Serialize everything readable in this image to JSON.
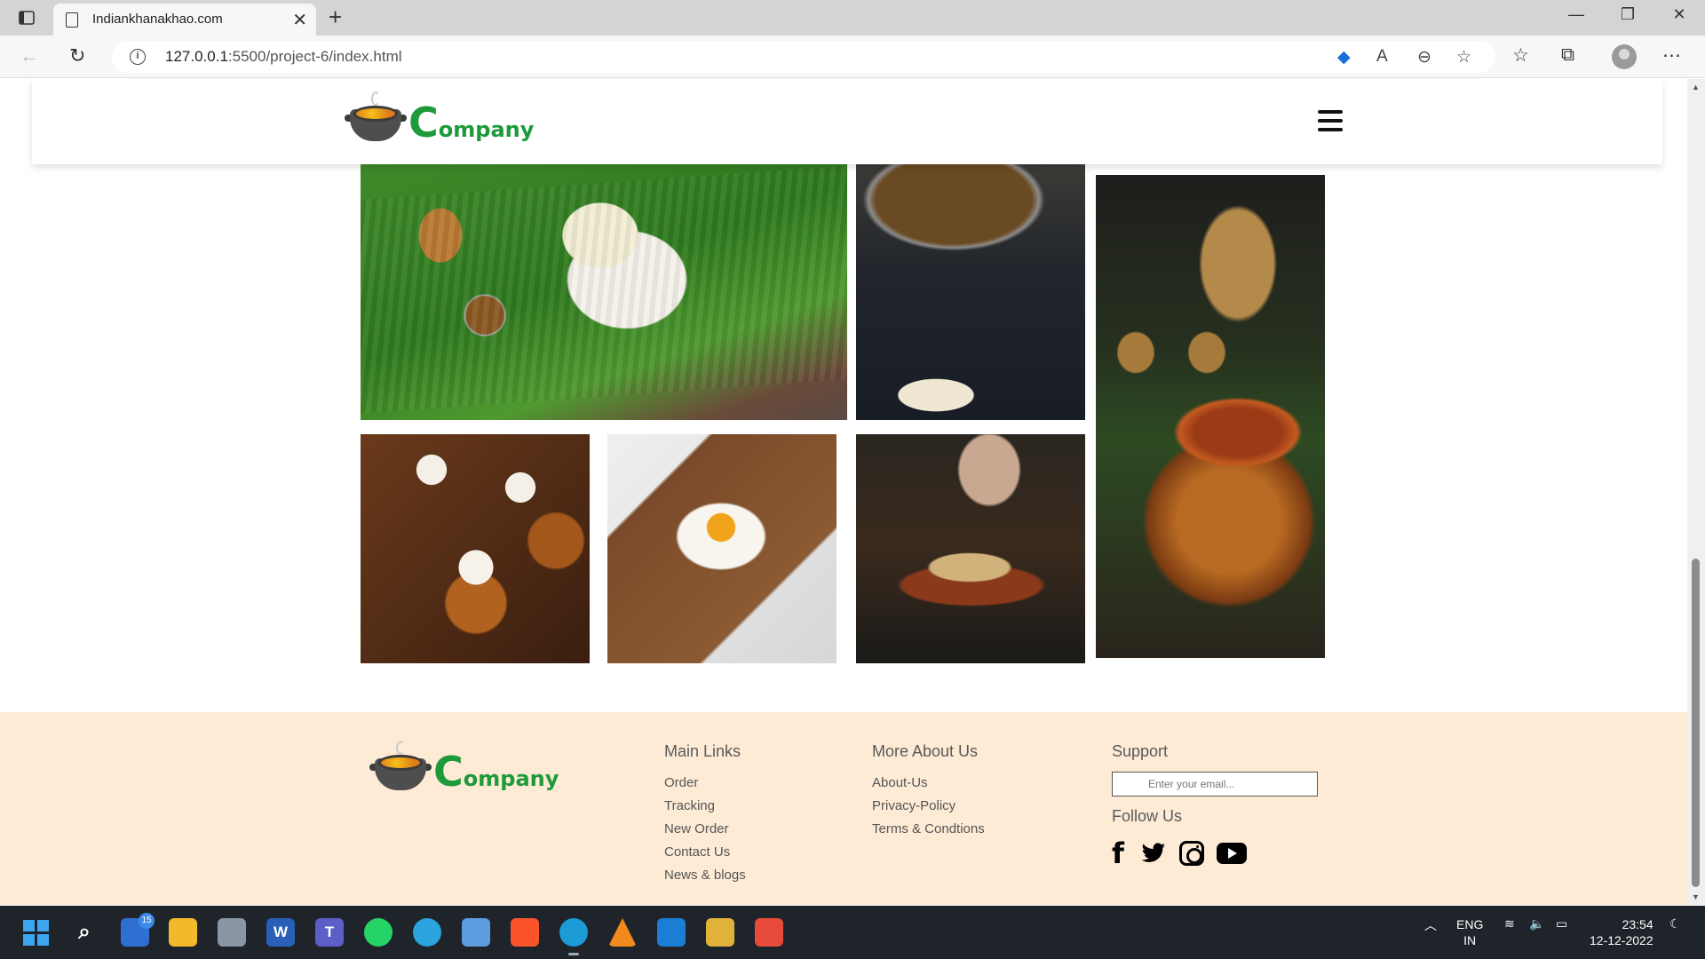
{
  "browser": {
    "tab_title": "Indiankhanakhao.com",
    "tab_close": "✕",
    "new_tab": "+",
    "url_host": "127.0.0.1",
    "url_path": ":5500/project-6/index.html",
    "window_controls": {
      "minimize": "—",
      "restore": "❐",
      "close": "✕"
    }
  },
  "site": {
    "logo_initial": "C",
    "logo_rest": "ompany",
    "brand_color": "#1d9a3a"
  },
  "footer": {
    "main_links": {
      "heading": "Main Links",
      "items": [
        "Order",
        "Tracking",
        "New Order",
        "Contact Us",
        "News & blogs"
      ]
    },
    "more_about": {
      "heading": "More About Us",
      "items": [
        "About-Us",
        "Privacy-Policy",
        "Terms & Condtions"
      ]
    },
    "support": {
      "heading": "Support",
      "email_placeholder": "Enter your email...",
      "follow_heading": "Follow Us",
      "fb_glyph": "f"
    },
    "background": "#fdebd6"
  },
  "taskbar": {
    "store_badge": "15",
    "word_letter": "W",
    "teams_letter": "T",
    "lang_line1": "ENG",
    "lang_line2": "IN",
    "time": "23:54",
    "date": "12-12-2022"
  }
}
